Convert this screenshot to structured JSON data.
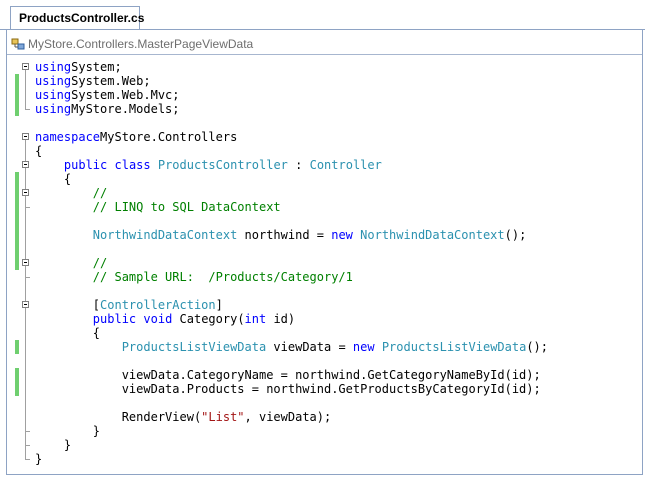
{
  "tab": {
    "title": "ProductsController.cs"
  },
  "nav": {
    "label": "MyStore.Controllers.MasterPageViewData",
    "icon": "class-member-icon"
  },
  "code": {
    "lines": [
      [
        [
          "kw",
          "using"
        ],
        [
          "",
          "System;"
        ]
      ],
      [
        [
          "kw",
          "using"
        ],
        [
          "",
          "System.Web;"
        ]
      ],
      [
        [
          "kw",
          "using"
        ],
        [
          "",
          "System.Web.Mvc;"
        ]
      ],
      [
        [
          "kw",
          "using"
        ],
        [
          "",
          "MyStore.Models;"
        ]
      ],
      [],
      [
        [
          "kw",
          "namespace"
        ],
        [
          "",
          "MyStore.Controllers"
        ]
      ],
      [
        [
          "",
          "{"
        ]
      ],
      [
        [
          "",
          "    "
        ],
        [
          "kw",
          "public"
        ],
        [
          "",
          " "
        ],
        [
          "kw",
          "class"
        ],
        [
          "",
          " "
        ],
        [
          "ty",
          "ProductsController"
        ],
        [
          "",
          " : "
        ],
        [
          "ty",
          "Controller"
        ]
      ],
      [
        [
          "",
          "    {"
        ]
      ],
      [
        [
          "",
          "        "
        ],
        [
          "cm",
          "//"
        ]
      ],
      [
        [
          "",
          "        "
        ],
        [
          "cm",
          "// LINQ to SQL DataContext"
        ]
      ],
      [],
      [
        [
          "",
          "        "
        ],
        [
          "ty",
          "NorthwindDataContext"
        ],
        [
          "",
          " northwind = "
        ],
        [
          "kw",
          "new"
        ],
        [
          "",
          " "
        ],
        [
          "ty",
          "NorthwindDataContext"
        ],
        [
          "",
          "();"
        ]
      ],
      [],
      [
        [
          "",
          "        "
        ],
        [
          "cm",
          "//"
        ]
      ],
      [
        [
          "",
          "        "
        ],
        [
          "cm",
          "// Sample URL:  /Products/Category/1"
        ]
      ],
      [],
      [
        [
          "",
          "        ["
        ],
        [
          "ty",
          "ControllerAction"
        ],
        [
          "",
          "]"
        ]
      ],
      [
        [
          "",
          "        "
        ],
        [
          "kw",
          "public"
        ],
        [
          "",
          " "
        ],
        [
          "kw",
          "void"
        ],
        [
          "",
          " Category("
        ],
        [
          "kw",
          "int"
        ],
        [
          "",
          " id)"
        ]
      ],
      [
        [
          "",
          "        {"
        ]
      ],
      [
        [
          "",
          "            "
        ],
        [
          "ty",
          "ProductsListViewData"
        ],
        [
          "",
          " viewData = "
        ],
        [
          "kw",
          "new"
        ],
        [
          "",
          " "
        ],
        [
          "ty",
          "ProductsListViewData"
        ],
        [
          "",
          "();"
        ]
      ],
      [],
      [
        [
          "",
          "            viewData.CategoryName = northwind.GetCategoryNameById(id);"
        ]
      ],
      [
        [
          "",
          "            viewData.Products = northwind.GetProductsByCategoryId(id);"
        ]
      ],
      [],
      [
        [
          "",
          "            RenderView("
        ],
        [
          "st",
          "\"List\""
        ],
        [
          "",
          ", viewData);"
        ]
      ],
      [
        [
          "",
          "        }"
        ]
      ],
      [
        [
          "",
          "    }"
        ]
      ],
      [
        [
          "",
          "}"
        ]
      ]
    ]
  }
}
